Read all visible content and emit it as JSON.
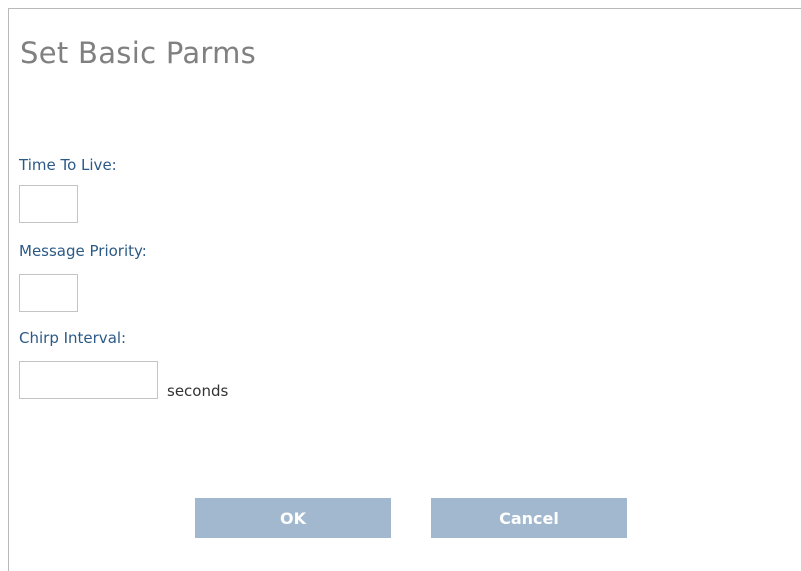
{
  "dialog": {
    "title": "Set Basic Parms"
  },
  "form": {
    "time_to_live": {
      "label": "Time To Live:",
      "value": ""
    },
    "message_priority": {
      "label": "Message Priority:",
      "value": ""
    },
    "chirp_interval": {
      "label": "Chirp Interval:",
      "value": "",
      "unit": "seconds"
    }
  },
  "buttons": {
    "ok_label": "OK",
    "cancel_label": "Cancel"
  },
  "colors": {
    "title": "#808080",
    "label": "#2b5a86",
    "button_bg": "#a2b8cf",
    "button_text": "#ffffff",
    "border": "#b9b9b9"
  }
}
